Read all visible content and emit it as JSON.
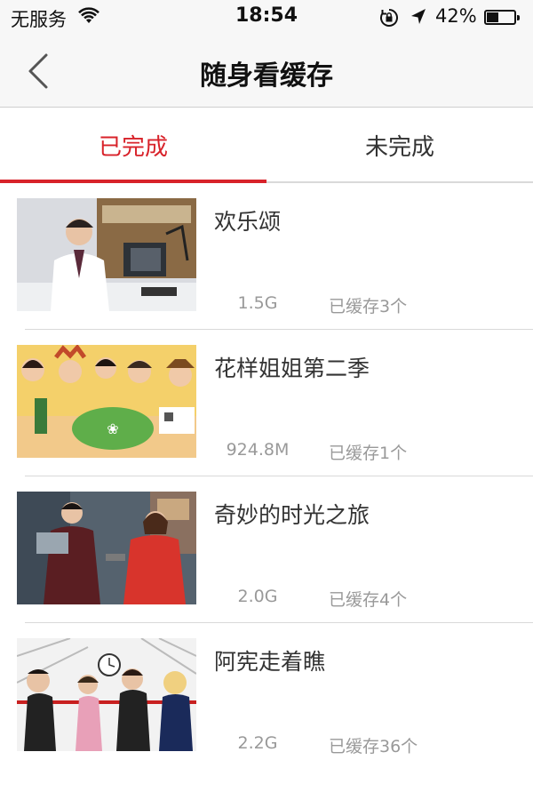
{
  "status_bar": {
    "carrier": "无服务",
    "time": "18:54",
    "battery_percent": "42%",
    "battery_level": 0.42,
    "icons": [
      "wifi-icon",
      "orientation-lock-icon",
      "location-arrow-icon",
      "battery-icon"
    ]
  },
  "nav": {
    "title": "随身看缓存",
    "back_icon": "chevron-left-icon"
  },
  "tabs": {
    "done_label": "已完成",
    "undone_label": "未完成",
    "active": "done"
  },
  "colors": {
    "accent": "#d8222a",
    "text": "#333333",
    "muted": "#999999",
    "divider": "#d9d9d9",
    "bar_bg": "#f7f7f7"
  },
  "items": [
    {
      "title": "欢乐颂",
      "size": "1.5G",
      "count": "已缓存3个"
    },
    {
      "title": "花样姐姐第二季",
      "size": "924.8M",
      "count": "已缓存1个"
    },
    {
      "title": "奇妙的时光之旅",
      "size": "2.0G",
      "count": "已缓存4个"
    },
    {
      "title": "阿宪走着瞧",
      "size": "2.2G",
      "count": "已缓存36个"
    }
  ]
}
